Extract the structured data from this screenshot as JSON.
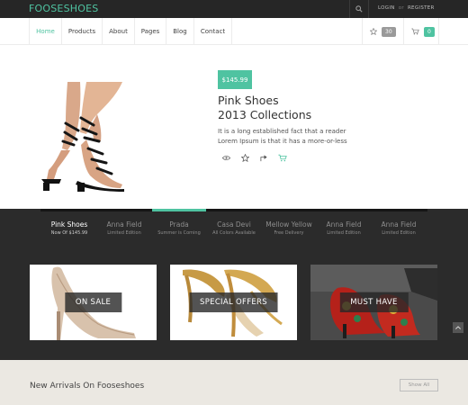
{
  "topbar": {
    "logo": "FOOSESHOES",
    "login": "LOGIN",
    "or": "or",
    "register": "REGISTER",
    "search_icon": "search-icon"
  },
  "nav": {
    "items": [
      {
        "label": "Home",
        "active": true
      },
      {
        "label": "Products",
        "active": false
      },
      {
        "label": "About",
        "active": false
      },
      {
        "label": "Pages",
        "active": false
      },
      {
        "label": "Blog",
        "active": false
      },
      {
        "label": "Contact",
        "active": false
      }
    ],
    "wishlist_count": "30",
    "cart_count": "0"
  },
  "hero": {
    "price": "$145.99",
    "title_line1": "Pink Shoes",
    "title_line2": "2013 Collections",
    "desc_line1": "It is a long established fact that a reader",
    "desc_line2": "Lorem Ipsum is that it has a more-or-less",
    "actions": [
      "eye-icon",
      "star-icon",
      "share-icon",
      "cart-icon"
    ]
  },
  "slider": {
    "items": [
      {
        "title": "Pink Shoes",
        "subtitle": "Now Of $145.99",
        "active": true
      },
      {
        "title": "Anna Field",
        "subtitle": "Limited Edition",
        "active": false
      },
      {
        "title": "Prada",
        "subtitle": "Summer is Coming",
        "active": false
      },
      {
        "title": "Casa Devi",
        "subtitle": "All Colors Available",
        "active": false
      },
      {
        "title": "Mellow Yellow",
        "subtitle": "Free Delivery",
        "active": false
      },
      {
        "title": "Anna Field",
        "subtitle": "Limited Edition",
        "active": false
      },
      {
        "title": "Anna Field",
        "subtitle": "Limited Edition",
        "active": false
      }
    ]
  },
  "promo": {
    "cards": [
      {
        "label": "ON SALE"
      },
      {
        "label": "SPECIAL OFFERS"
      },
      {
        "label": "MUST HAVE"
      }
    ]
  },
  "arrivals": {
    "title": "New Arrivals On Fooseshoes",
    "show_all": "Show All"
  },
  "colors": {
    "accent": "#4fc3a1",
    "dark": "#262626",
    "band": "#2b2b2b",
    "beige": "#ebe8e2"
  }
}
